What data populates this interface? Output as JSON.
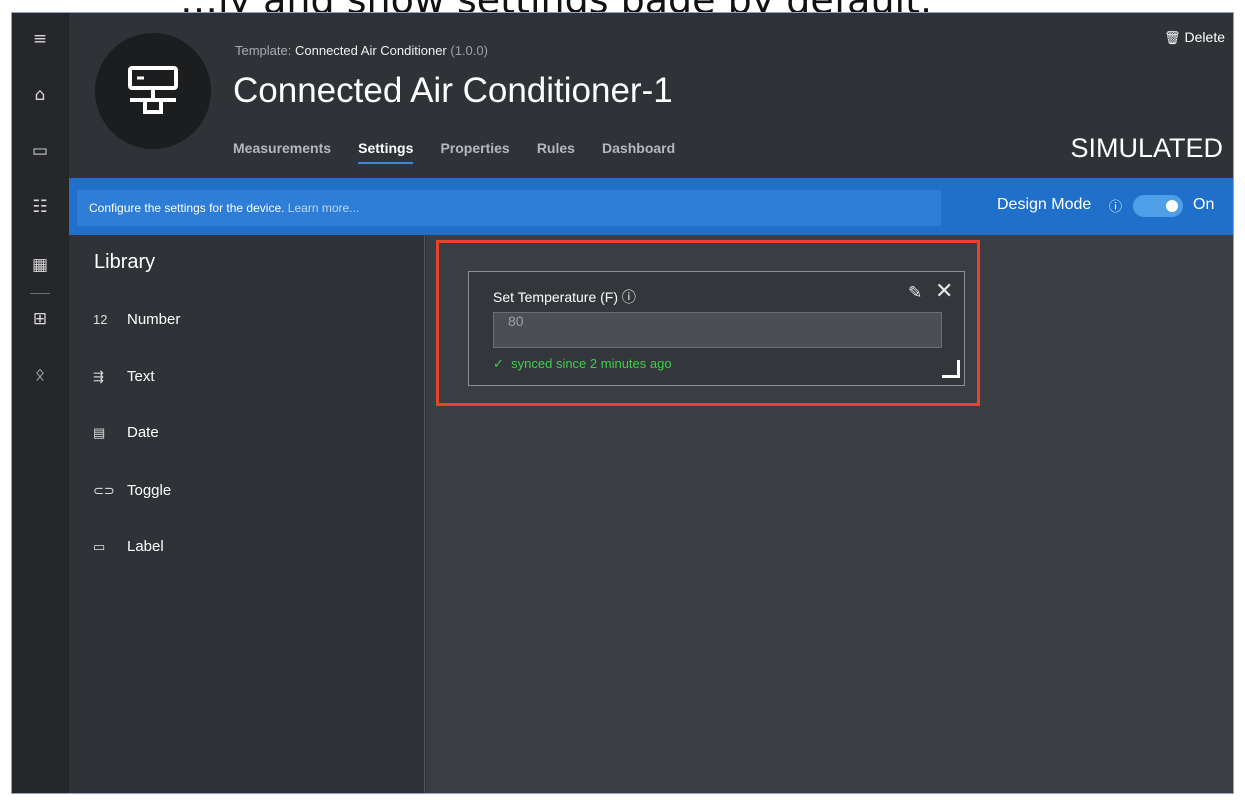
{
  "caption": {
    "text": "…ly and show settings page by default."
  },
  "rail": {
    "items": [
      {
        "icon": "menu-icon",
        "glyph": "≡"
      },
      {
        "icon": "home-icon",
        "glyph": "⌂"
      },
      {
        "icon": "device-icon",
        "glyph": "▭"
      },
      {
        "icon": "checklist-icon",
        "glyph": "☷"
      },
      {
        "icon": "analytics-icon",
        "glyph": "▦"
      },
      {
        "icon": "dashboard-icon",
        "glyph": "⊞"
      },
      {
        "icon": "users-icon",
        "glyph": "ᛟ"
      }
    ]
  },
  "header": {
    "template_prefix": "Template:",
    "template_name": "Connected Air Conditioner",
    "template_version": "(1.0.0)",
    "title": "Connected Air Conditioner-1",
    "delete_label": "Delete",
    "status": "SIMULATED",
    "tabs": [
      {
        "label": "Measurements",
        "active": false
      },
      {
        "label": "Settings",
        "active": true
      },
      {
        "label": "Properties",
        "active": false
      },
      {
        "label": "Rules",
        "active": false
      },
      {
        "label": "Dashboard",
        "active": false
      }
    ]
  },
  "infobar": {
    "message": "Configure the settings for the device.",
    "learn_more": "Learn more...",
    "design_mode_label": "Design Mode",
    "design_mode_state": "On"
  },
  "library": {
    "title": "Library",
    "items": [
      {
        "label": "Number",
        "icon": "number-icon",
        "glyph": "12"
      },
      {
        "label": "Text",
        "icon": "text-icon",
        "glyph": "⇶"
      },
      {
        "label": "Date",
        "icon": "date-icon",
        "glyph": "▤"
      },
      {
        "label": "Toggle",
        "icon": "toggle-icon",
        "glyph": "⊂⊃"
      },
      {
        "label": "Label",
        "icon": "label-icon",
        "glyph": "▭"
      }
    ]
  },
  "tile": {
    "label": "Set Temperature (F)",
    "value": "80",
    "status": "synced since 2 minutes ago"
  },
  "colors": {
    "accent": "#1f6fcb",
    "highlight": "#e8432b",
    "success": "#3ed04b"
  }
}
